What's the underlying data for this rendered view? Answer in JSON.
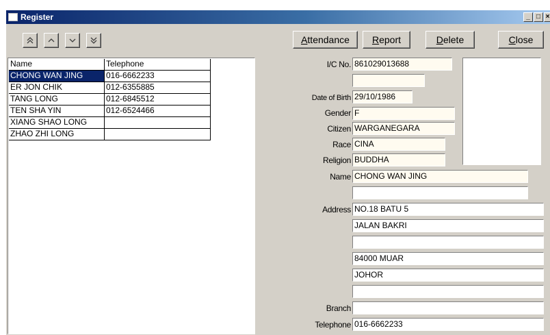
{
  "window": {
    "title": "Register"
  },
  "nav": {
    "first_icon": "double-chevron-up-icon",
    "prev_icon": "chevron-up-icon",
    "next_icon": "chevron-down-icon",
    "last_icon": "double-chevron-down-icon"
  },
  "buttons": {
    "attendance": {
      "ul": "A",
      "rest": "ttendance"
    },
    "report": {
      "ul": "R",
      "rest": "eport"
    },
    "delete": {
      "ul": "D",
      "rest": "elete"
    },
    "close": {
      "ul": "C",
      "rest": "lose"
    }
  },
  "grid": {
    "columns": [
      "Name",
      "Telephone"
    ],
    "rows": [
      {
        "name": "CHONG WAN JING",
        "telephone": "016-6662233",
        "selected": true
      },
      {
        "name": "ER JON CHIK",
        "telephone": "012-6355885"
      },
      {
        "name": "TANG LONG",
        "telephone": "012-6845512"
      },
      {
        "name": "TEN SHA YIN",
        "telephone": "012-6524466"
      },
      {
        "name": "XIANG SHAO LONG",
        "telephone": ""
      },
      {
        "name": "ZHAO ZHI LONG",
        "telephone": ""
      }
    ]
  },
  "form": {
    "labels": {
      "ic": "I/C No.",
      "dob": "Date of Birth",
      "gender": "Gender",
      "citizen": "Citizen",
      "race": "Race",
      "religion": "Religion",
      "name": "Name",
      "address": "Address",
      "branch": "Branch",
      "telephone": "Telephone"
    },
    "values": {
      "ic": "861029013688",
      "ic2": "",
      "dob": "29/10/1986",
      "gender": "F",
      "citizen": "WARGANEGARA",
      "race": "CINA",
      "religion": "BUDDHA",
      "name": "CHONG WAN JING",
      "name2": "",
      "address1": "NO.18 BATU 5",
      "address2": "JALAN BAKRI",
      "address3": "",
      "address4": "84000 MUAR",
      "address5": "JOHOR",
      "address6": "",
      "branch": "",
      "telephone": "016-6662233"
    }
  },
  "colors": {
    "selection": "#0a246a",
    "field_cream": "#fffbf0",
    "window_bg": "#d4d0c8"
  }
}
